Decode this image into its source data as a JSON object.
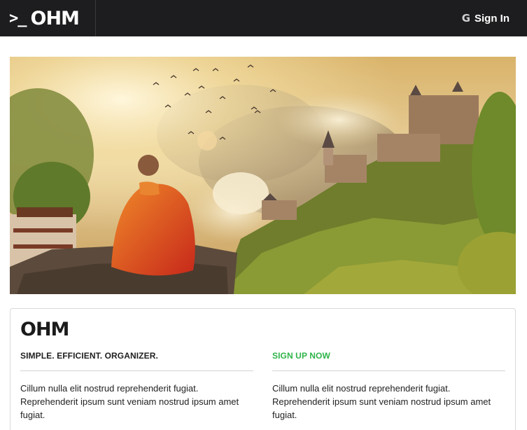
{
  "navbar": {
    "prompt_symbol": ">_",
    "brand": "OHM",
    "google_icon": "G",
    "signin_label": "Sign In"
  },
  "hero": {
    "image_description_icon": "meditating-monk-castle-image"
  },
  "card": {
    "logo": "OHM",
    "left": {
      "heading": "SIMPLE. EFFICIENT. ORGANIZER.",
      "text": "Cillum nulla elit nostrud reprehenderit fugiat. Reprehenderit ipsum sunt veniam nostrud ipsum amet fugiat."
    },
    "right": {
      "heading": "SIGN UP NOW",
      "text": "Cillum nulla elit nostrud reprehenderit fugiat. Reprehenderit ipsum sunt veniam nostrud ipsum amet fugiat."
    }
  },
  "colors": {
    "navbar_bg": "#1d1d1f",
    "accent_green": "#2fb44a"
  }
}
